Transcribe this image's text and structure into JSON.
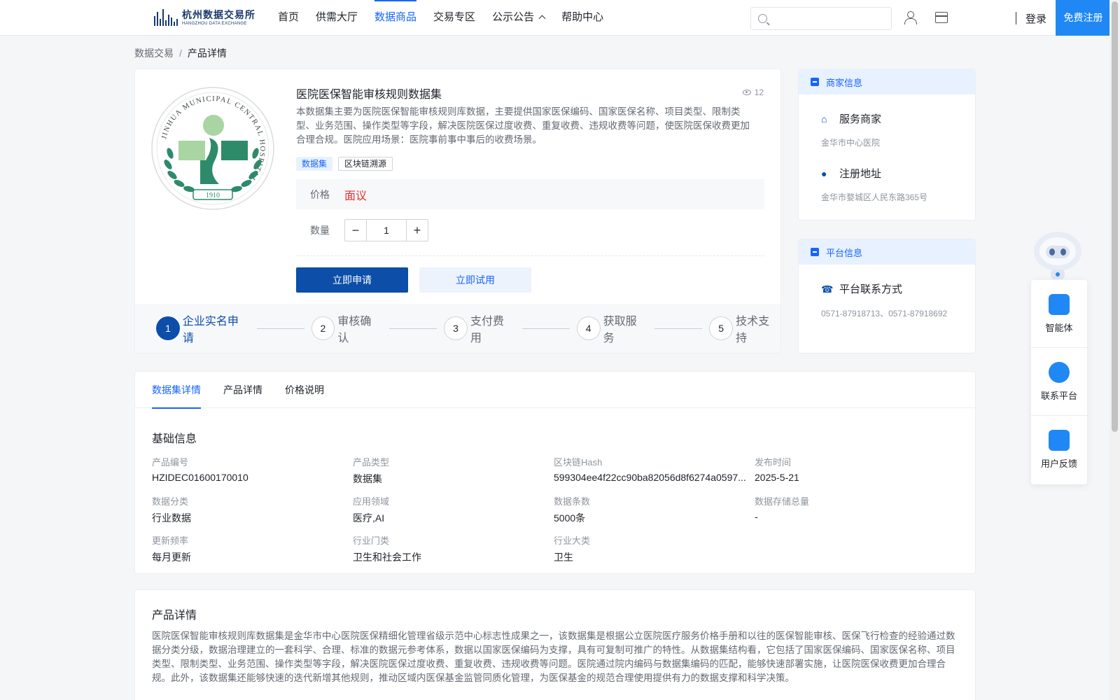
{
  "header": {
    "logo_cn": "杭州数据交易所",
    "logo_en": "HANGZHOU DATA EXCHANGE",
    "nav": [
      {
        "label": "首页"
      },
      {
        "label": "供需大厅"
      },
      {
        "label": "数据商品"
      },
      {
        "label": "交易专区"
      },
      {
        "label": "公示公告"
      },
      {
        "label": "帮助中心"
      }
    ],
    "search_placeholder": "",
    "login": "登录",
    "register": "免费注册"
  },
  "breadcrumb": {
    "root": "数据交易",
    "sep": "/",
    "current": "产品详情"
  },
  "product": {
    "title": "医院医保智能审核规则数据集",
    "views": "12",
    "description": "本数据集主要为医院医保智能审核规则库数据，主要提供国家医保编码、国家医保名称、项目类型、限制类型、业务范围、操作类型等字段，解决医院医保过度收费、重复收费、违规收费等问题，使医院医保收费更加合理合规。医院应用场景：医院事前事中事后的收费场景。",
    "tags": [
      "数据集",
      "区块链溯源"
    ],
    "price_label": "价格",
    "price_value": "面议",
    "qty_label": "数量",
    "qty_value": "1",
    "apply_label": "立即申请",
    "trial_label": "立即试用",
    "logo_ring_text": "JINHUA MUNICIPAL CENTRAL HOSPITAL",
    "logo_year": "1910"
  },
  "steps": [
    {
      "num": "1",
      "label": "企业实名申请"
    },
    {
      "num": "2",
      "label": "审核确认"
    },
    {
      "num": "3",
      "label": "支付费用"
    },
    {
      "num": "4",
      "label": "获取服务"
    },
    {
      "num": "5",
      "label": "技术支持"
    }
  ],
  "merchant": {
    "head": "商家信息",
    "service_title": "服务商家",
    "service_value": "金华市中心医院",
    "address_title": "注册地址",
    "address_value": "金华市婺城区人民东路365号"
  },
  "platform": {
    "head": "平台信息",
    "contact_title": "平台联系方式",
    "contact_value": "0571-87918713、0571-87918692"
  },
  "float_panel": [
    {
      "label": "智能体",
      "icon": "robot-icon"
    },
    {
      "label": "联系平台",
      "icon": "headset-icon"
    },
    {
      "label": "用户反馈",
      "icon": "feedback-icon"
    }
  ],
  "tabs": [
    {
      "label": "数据集详情"
    },
    {
      "label": "产品详情"
    },
    {
      "label": "价格说明"
    }
  ],
  "basic_info": {
    "title": "基础信息",
    "fields": [
      {
        "label": "产品编号",
        "value": "HZIDEC01600170010"
      },
      {
        "label": "产品类型",
        "value": "数据集"
      },
      {
        "label": "区块链Hash",
        "value": "599304ee4f22cc90ba82056d8f6274a0597..."
      },
      {
        "label": "发布时间",
        "value": "2025-5-21"
      },
      {
        "label": "数据分类",
        "value": "行业数据"
      },
      {
        "label": "应用领域",
        "value": "医疗,AI"
      },
      {
        "label": "数据条数",
        "value": "5000条"
      },
      {
        "label": "数据存储总量",
        "value": "-"
      },
      {
        "label": "更新频率",
        "value": "每月更新"
      },
      {
        "label": "行业门类",
        "value": "卫生和社会工作"
      },
      {
        "label": "行业大类",
        "value": "卫生"
      }
    ]
  },
  "product_detail": {
    "title": "产品详情",
    "text": "医院医保智能审核规则库数据集是金华市中心医院医保精细化管理省级示范中心标志性成果之一，该数据集是根据公立医院医疗服务价格手册和以往的医保智能审核、医保飞行检查的经验通过数据分类分级，数据治理建立的一套科学、合理、标准的数据元参考体系，数据以国家医保编码为支撑，具有可复制可推广的特性。从数据集结构看，它包括了国家医保编码、国家医保名称、项目类型、限制类型、业务范围、操作类型等字段，解决医院医保过度收费、重复收费、违规收费等问题。医院通过院内编码与数据集编码的匹配，能够快速部署实施，让医院医保收费更加合理合规。此外，该数据集还能够快速的迭代新增其他规则，推动区域内医保基金监管同质化管理，为医保基金的规范合理使用提供有力的数据支撑和科学决策。"
  }
}
